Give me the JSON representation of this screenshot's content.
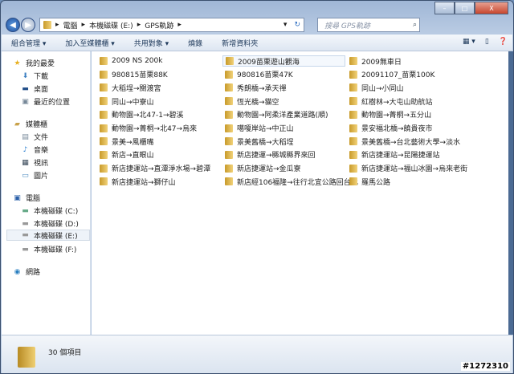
{
  "window": {
    "minimize": "–",
    "maximize": "□",
    "close": "X"
  },
  "address": {
    "crumbs": [
      "電腦",
      "本機磁碟 (E:)",
      "GPS軌跡"
    ]
  },
  "search": {
    "placeholder": "搜尋 GPS軌跡"
  },
  "toolbar": {
    "organize": "組合管理 ▾",
    "include_library": "加入至媒體櫃 ▾",
    "share": "共用對象 ▾",
    "burn": "燒錄",
    "new_folder": "新增資料夾"
  },
  "navpane": {
    "favorites": {
      "label": "我的最愛",
      "items": [
        "下載",
        "桌面",
        "最近的位置"
      ]
    },
    "libraries": {
      "label": "媒體櫃",
      "items": [
        "文件",
        "音樂",
        "視訊",
        "圖片"
      ]
    },
    "computer": {
      "label": "電腦",
      "items": [
        "本機磁碟 (C:)",
        "本機磁碟 (D:)",
        "本機磁碟 (E:)",
        "本機磁碟 (F:)"
      ]
    },
    "network": {
      "label": "網路"
    }
  },
  "folders": {
    "columns": [
      [
        "2009 NS 200k",
        "980815苗栗88K",
        "大稻埕→關渡宮",
        "同山→中寮山",
        "動物園→北47-1→碧溪",
        "動物園→菁桐→北47→烏來",
        "景美→風櫃嘴",
        "新店→直眼山",
        "新店捷運站→直潭淨水場→碧潭",
        "新店捷運站→獅仔山"
      ],
      [
        "2009苗栗遊山觀海",
        "980816苗栗47K",
        "秀朗橋→承天禪",
        "恆光橋→貓空",
        "動物園→阿柔洋產業道路(順)",
        "噶嗄岸站→中正山",
        "景美舊橋→大稻埕",
        "新店捷運→縣城縣界來回",
        "新店捷運站→金瓜寮",
        "新店經106福隆→往行北宜公路回台北"
      ],
      [
        "2009無車日",
        "20091107_苗栗100K",
        "同山→小同山",
        "紅樹林→大屯山助航站",
        "動物園→菁桐→五分山",
        "景安福北橋→饒貴夜市",
        "景美舊橋→台北藝術大學→淡水",
        "新店捷運站→昆陽捷運站",
        "新店捷運站→福山冰園→烏來老街",
        "羅馬公路"
      ]
    ]
  },
  "status": {
    "count": "30 個項目"
  },
  "watermark": "#1272310"
}
